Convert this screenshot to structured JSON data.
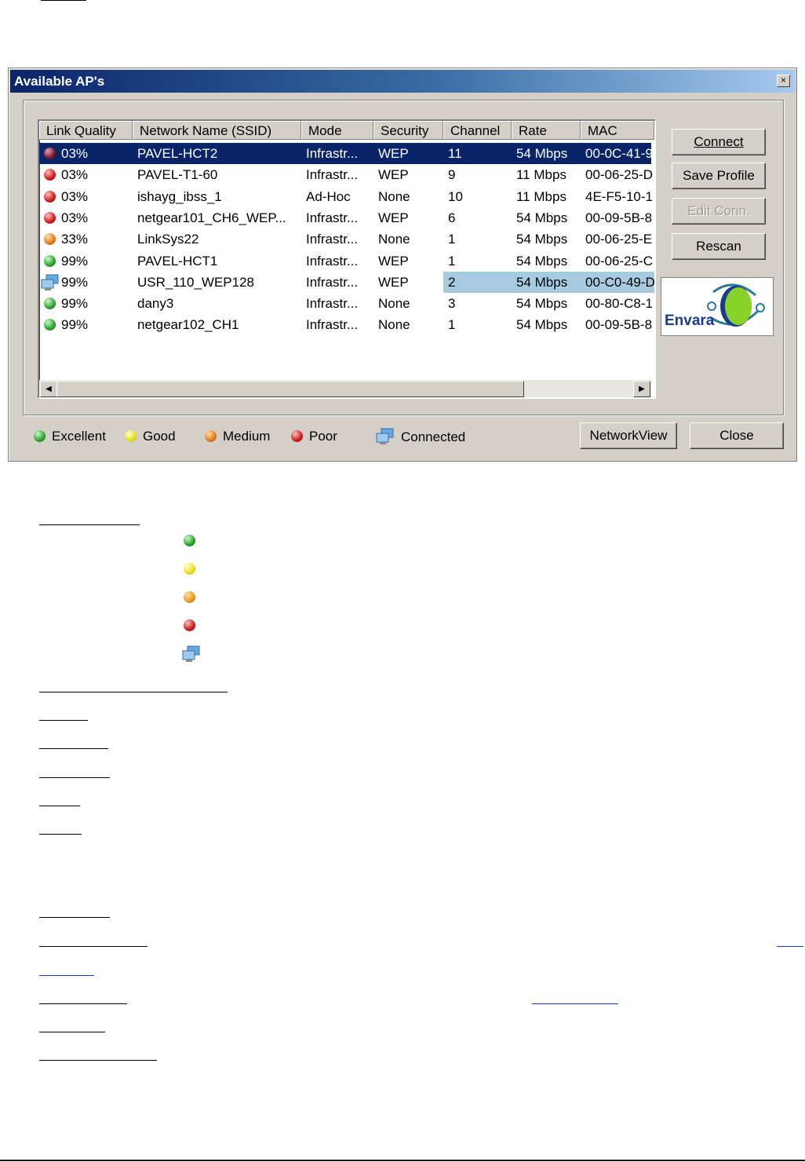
{
  "dialog": {
    "title": "Available AP's",
    "close_glyph": "×",
    "columns": [
      "Link Quality",
      "Network Name (SSID)",
      "Mode",
      "Security",
      "Channel",
      "Rate",
      "MAC"
    ],
    "rows": [
      {
        "quality": "03%",
        "icon": "poor-dark",
        "ssid": "PAVEL-HCT2",
        "mode": "Infrastr...",
        "security": "WEP",
        "channel": "11",
        "rate": "54 Mbps",
        "mac": "00-0C-41-9"
      },
      {
        "quality": "03%",
        "icon": "poor",
        "ssid": "PAVEL-T1-60",
        "mode": "Infrastr...",
        "security": "WEP",
        "channel": "9",
        "rate": "11 Mbps",
        "mac": "00-06-25-D"
      },
      {
        "quality": "03%",
        "icon": "poor",
        "ssid": "ishayg_ibss_1",
        "mode": "Ad-Hoc",
        "security": "None",
        "channel": "10",
        "rate": "11 Mbps",
        "mac": "4E-F5-10-1"
      },
      {
        "quality": "03%",
        "icon": "poor",
        "ssid": "netgear101_CH6_WEP...",
        "mode": "Infrastr...",
        "security": "WEP",
        "channel": "6",
        "rate": "54 Mbps",
        "mac": "00-09-5B-8"
      },
      {
        "quality": "33%",
        "icon": "medium",
        "ssid": "LinkSys22",
        "mode": "Infrastr...",
        "security": "None",
        "channel": "1",
        "rate": "54 Mbps",
        "mac": "00-06-25-E"
      },
      {
        "quality": "99%",
        "icon": "excellent",
        "ssid": "PAVEL-HCT1",
        "mode": "Infrastr...",
        "security": "WEP",
        "channel": "1",
        "rate": "54 Mbps",
        "mac": "00-06-25-C"
      },
      {
        "quality": "99%",
        "icon": "connected",
        "ssid": "USR_110_WEP128",
        "mode": "Infrastr...",
        "security": "WEP",
        "channel": "2",
        "rate": "54 Mbps",
        "mac": "00-C0-49-D"
      },
      {
        "quality": "99%",
        "icon": "excellent",
        "ssid": "dany3",
        "mode": "Infrastr...",
        "security": "None",
        "channel": "3",
        "rate": "54 Mbps",
        "mac": "00-80-C8-1"
      },
      {
        "quality": "99%",
        "icon": "excellent",
        "ssid": "netgear102_CH1",
        "mode": "Infrastr...",
        "security": "None",
        "channel": "1",
        "rate": "54 Mbps",
        "mac": "00-09-5B-8"
      }
    ],
    "buttons": {
      "connect": "Connect",
      "save_profile": "Save Profile",
      "edit_conn": "Edit Conn.",
      "rescan": "Rescan",
      "network_view": "NetworkView",
      "close": "Close"
    },
    "logo_text": "Envara",
    "legend": {
      "excellent": "Excellent",
      "good": "Good",
      "medium": "Medium",
      "poor": "Poor",
      "connected": "Connected"
    }
  },
  "colors": {
    "excellent": "#2e9e2e",
    "good": "#e8d21a",
    "medium": "#e07a1a",
    "poor": "#cc1a1a",
    "poor_dark": "#7a1a2a",
    "selection": "#0a246a",
    "highlight": "#a6cae0"
  }
}
